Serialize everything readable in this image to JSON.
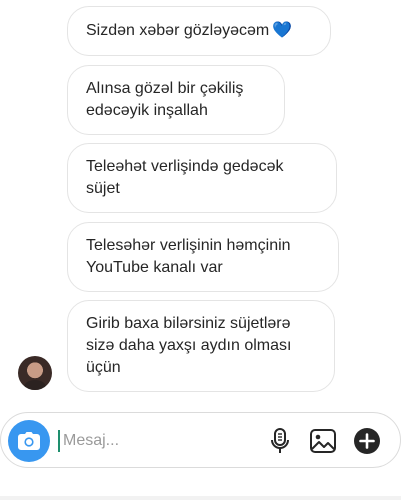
{
  "messages": [
    {
      "text": "Sizdən xəbər gözləyəcəm",
      "emoji": "💙"
    },
    {
      "line1": "Alınsa gözəl bir çəkiliş",
      "line2": "edəcəyik inşallah"
    },
    {
      "line1": "Teleəhət verlişində gedəcək",
      "line2": "süjet"
    },
    {
      "line1": "Telesəhər verlişinin həmçinin",
      "line2": "YouTube kanalı var"
    },
    {
      "line1": "Girib baxa bilərsiniz süjetlərə",
      "line2": "sizə daha yaxşı aydın olması",
      "line3": "üçün"
    }
  ],
  "composer": {
    "placeholder": "Mesaj...",
    "accent_color": "#3897f0"
  },
  "icons": {
    "camera": "camera-icon",
    "mic": "microphone-icon",
    "gallery": "image-gallery-icon",
    "plus": "plus-circle-icon",
    "heart": "blue-heart-emoji"
  }
}
